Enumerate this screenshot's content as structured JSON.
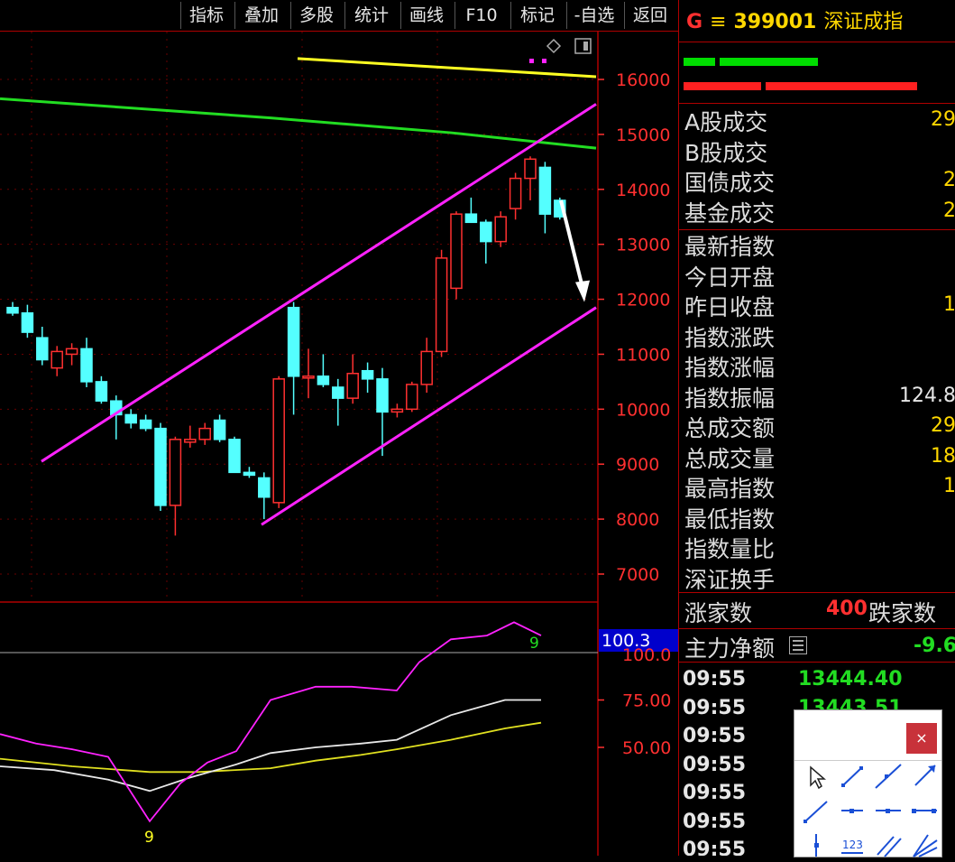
{
  "toolbar": {
    "buttons": [
      "指标",
      "叠加",
      "多股",
      "统计",
      "画线",
      "F10",
      "标记",
      "-自选",
      "返回"
    ]
  },
  "header": {
    "flag": "G",
    "menu": "≡",
    "code": "399001",
    "name": "深证成指"
  },
  "quote_rows": [
    {
      "label": "A股成交",
      "value": "29"
    },
    {
      "label": "B股成交",
      "value": ""
    },
    {
      "label": "国债成交",
      "value": "2"
    },
    {
      "label": "基金成交",
      "value": "2"
    },
    {
      "label": "最新指数",
      "value": ""
    },
    {
      "label": "今日开盘",
      "value": ""
    },
    {
      "label": "昨日收盘",
      "value": "1"
    },
    {
      "label": "指数涨跌",
      "value": ""
    },
    {
      "label": "指数涨幅",
      "value": ""
    },
    {
      "label": "指数振幅",
      "value": "124.8"
    },
    {
      "label": "总成交额",
      "value": "29"
    },
    {
      "label": "总成交量",
      "value": "18"
    },
    {
      "label": "最高指数",
      "value": "1"
    },
    {
      "label": "最低指数",
      "value": ""
    },
    {
      "label": "指数量比",
      "value": ""
    },
    {
      "label": "深证换手",
      "value": ""
    }
  ],
  "breadth": {
    "up_label": "涨家数",
    "up_count": "400",
    "down_label": "跌家数"
  },
  "main_force": {
    "label": "主力净额",
    "value": "-9.6"
  },
  "ticks": [
    {
      "time": "09:55",
      "value": "13444.40"
    },
    {
      "time": "09:55",
      "value": "13443.51"
    },
    {
      "time": "09:55",
      "value": ""
    },
    {
      "time": "09:55",
      "value": ""
    },
    {
      "time": "09:55",
      "value": ""
    },
    {
      "time": "09:55",
      "value": ""
    },
    {
      "time": "09:55",
      "value": ""
    }
  ],
  "drawing_tools": {
    "close_symbol": "×",
    "items": [
      "cursor-icon",
      "line-segment-icon",
      "straight-line-icon",
      "ray-icon",
      "parallel-line-icon",
      "horizontal-segment-icon",
      "horizontal-line-icon",
      "horizontal-ray-icon",
      "vertical-line-icon",
      "counter-icon",
      "parallel-channel-icon",
      "fan-lines-icon"
    ],
    "counter_label": "123"
  },
  "colors": {
    "up": "#ff3030",
    "down": "#54ffff",
    "ma_long": "#22dd22",
    "ma_top": "#ffff22",
    "channel": "#ff22ff",
    "axis": "#ff3030",
    "grid": "#6a0000"
  },
  "chart_data": {
    "type": "candlestick",
    "price_axis": {
      "ticks": [
        7000,
        8000,
        9000,
        10000,
        11000,
        12000,
        13000,
        14000,
        15000,
        16000
      ]
    },
    "indicator_axis": {
      "ticks": [
        "75.00",
        "50.00"
      ],
      "current_value_label": "100.3",
      "partial_label": "100.0",
      "marker_high": "9",
      "marker_low": "9"
    },
    "candles": [
      {
        "o": 11850,
        "h": 11950,
        "l": 11700,
        "c": 11750
      },
      {
        "o": 11750,
        "h": 11900,
        "l": 11300,
        "c": 11400
      },
      {
        "o": 11300,
        "h": 11500,
        "l": 10800,
        "c": 10900
      },
      {
        "o": 10750,
        "h": 11150,
        "l": 10600,
        "c": 11050
      },
      {
        "o": 11000,
        "h": 11200,
        "l": 10800,
        "c": 11100
      },
      {
        "o": 11100,
        "h": 11300,
        "l": 10400,
        "c": 10500
      },
      {
        "o": 10500,
        "h": 10600,
        "l": 10100,
        "c": 10150
      },
      {
        "o": 10150,
        "h": 10250,
        "l": 9450,
        "c": 9900
      },
      {
        "o": 9900,
        "h": 10000,
        "l": 9650,
        "c": 9750
      },
      {
        "o": 9800,
        "h": 9900,
        "l": 9600,
        "c": 9650
      },
      {
        "o": 9650,
        "h": 9750,
        "l": 8150,
        "c": 8250
      },
      {
        "o": 8250,
        "h": 9500,
        "l": 7700,
        "c": 9450
      },
      {
        "o": 9400,
        "h": 9700,
        "l": 9300,
        "c": 9450
      },
      {
        "o": 9450,
        "h": 9750,
        "l": 9350,
        "c": 9650
      },
      {
        "o": 9800,
        "h": 9900,
        "l": 9400,
        "c": 9450
      },
      {
        "o": 9450,
        "h": 9500,
        "l": 8850,
        "c": 8850
      },
      {
        "o": 8850,
        "h": 8950,
        "l": 8750,
        "c": 8800
      },
      {
        "o": 8750,
        "h": 8850,
        "l": 8000,
        "c": 8400
      },
      {
        "o": 8300,
        "h": 10600,
        "l": 8200,
        "c": 10550
      },
      {
        "o": 11850,
        "h": 11950,
        "l": 9900,
        "c": 10600
      },
      {
        "o": 10600,
        "h": 11100,
        "l": 10200,
        "c": 10600
      },
      {
        "o": 10600,
        "h": 11000,
        "l": 10400,
        "c": 10450
      },
      {
        "o": 10400,
        "h": 10550,
        "l": 9700,
        "c": 10200
      },
      {
        "o": 10200,
        "h": 11000,
        "l": 10100,
        "c": 10650
      },
      {
        "o": 10700,
        "h": 10850,
        "l": 10300,
        "c": 10550
      },
      {
        "o": 10550,
        "h": 10750,
        "l": 9150,
        "c": 9950
      },
      {
        "o": 9950,
        "h": 10100,
        "l": 9850,
        "c": 10000
      },
      {
        "o": 10000,
        "h": 10500,
        "l": 9950,
        "c": 10450
      },
      {
        "o": 10450,
        "h": 11300,
        "l": 10300,
        "c": 11050
      },
      {
        "o": 11050,
        "h": 12900,
        "l": 10950,
        "c": 12750
      },
      {
        "o": 12200,
        "h": 13600,
        "l": 12000,
        "c": 13550
      },
      {
        "o": 13550,
        "h": 13850,
        "l": 13400,
        "c": 13400
      },
      {
        "o": 13400,
        "h": 13450,
        "l": 12650,
        "c": 13050
      },
      {
        "o": 13050,
        "h": 13600,
        "l": 12950,
        "c": 13500
      },
      {
        "o": 13650,
        "h": 14300,
        "l": 13450,
        "c": 14200
      },
      {
        "o": 14200,
        "h": 14600,
        "l": 13800,
        "c": 14550
      },
      {
        "o": 14400,
        "h": 14500,
        "l": 13200,
        "c": 13550
      },
      {
        "o": 13800,
        "h": 13850,
        "l": 13450,
        "c": 13500
      }
    ],
    "ma_long": [
      [
        0,
        15650
      ],
      [
        300,
        15300
      ],
      [
        500,
        15030
      ],
      [
        661,
        14750
      ]
    ],
    "ma_top": [
      [
        330,
        16380
      ],
      [
        661,
        16050
      ]
    ],
    "channel_upper": [
      [
        46,
        9050
      ],
      [
        661,
        15550
      ]
    ],
    "channel_lower": [
      [
        290,
        7900
      ],
      [
        661,
        11850
      ]
    ],
    "arrow": [
      [
        622,
        13800
      ],
      [
        648,
        11950
      ]
    ],
    "osc_purple": [
      [
        0,
        57
      ],
      [
        40,
        52
      ],
      [
        80,
        49
      ],
      [
        120,
        45
      ],
      [
        166,
        11
      ],
      [
        200,
        31
      ],
      [
        230,
        42
      ],
      [
        262,
        48
      ],
      [
        300,
        75
      ],
      [
        350,
        82
      ],
      [
        390,
        82
      ],
      [
        440,
        80
      ],
      [
        465,
        95
      ],
      [
        500,
        107
      ],
      [
        540,
        109
      ],
      [
        570,
        116
      ],
      [
        600,
        109
      ]
    ],
    "osc_white": [
      [
        0,
        40
      ],
      [
        60,
        38
      ],
      [
        120,
        33
      ],
      [
        166,
        27
      ],
      [
        210,
        34
      ],
      [
        262,
        41
      ],
      [
        300,
        47
      ],
      [
        350,
        50
      ],
      [
        400,
        52
      ],
      [
        440,
        54
      ],
      [
        500,
        67
      ],
      [
        560,
        75
      ],
      [
        600,
        75
      ]
    ],
    "osc_yellow": [
      [
        0,
        44
      ],
      [
        80,
        40
      ],
      [
        166,
        37
      ],
      [
        220,
        37
      ],
      [
        300,
        39
      ],
      [
        350,
        43
      ],
      [
        400,
        46
      ],
      [
        440,
        49
      ],
      [
        500,
        54
      ],
      [
        560,
        60
      ],
      [
        600,
        63
      ]
    ]
  }
}
